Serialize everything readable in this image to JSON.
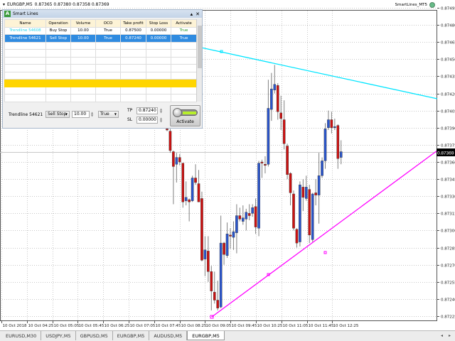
{
  "header": {
    "symbol": "EURGBP,M5",
    "prices": "0.87365 0.87380 0.87358 0.87369",
    "ea_name": "SmartLines_MT5"
  },
  "chart_data": {
    "type": "candlestick",
    "symbol": "EURGBP",
    "timeframe": "M5",
    "y_ticks": [
      "0.87495",
      "0.87480",
      "0.87465",
      "0.87450",
      "0.87435",
      "0.87420",
      "0.87405",
      "0.87390",
      "0.87375",
      "0.87360",
      "0.87345",
      "0.87330",
      "0.87315",
      "0.87300",
      "0.87285",
      "0.87270",
      "0.87255",
      "0.87240",
      "0.87225"
    ],
    "ylim": [
      0.87225,
      0.87495
    ],
    "x_ticks": [
      "10 Oct 2018",
      "10 Oct 04:25",
      "10 Oct 05:05",
      "10 Oct 05:45",
      "10 Oct 06:25",
      "10 Oct 07:05",
      "10 Oct 07:45",
      "10 Oct 08:25",
      "10 Oct 09:05",
      "10 Oct 09:45",
      "10 Oct 10:25",
      "10 Oct 11:05",
      "10 Oct 11:45",
      "10 Oct 12:25"
    ],
    "current_price": "0.87369",
    "bull_color": "#2a55cc",
    "bear_color": "#cc1111",
    "candles_ohlc_1e5": [
      [
        87389,
        87390,
        87387,
        87388
      ],
      [
        87387,
        87389,
        87368,
        87370
      ],
      [
        87369,
        87370,
        87323,
        87356
      ],
      [
        87358,
        87368,
        87342,
        87364
      ],
      [
        87364,
        87367,
        87357,
        87360
      ],
      [
        87359,
        87359,
        87320,
        87325
      ],
      [
        87326,
        87343,
        87322,
        87329
      ],
      [
        87327,
        87328,
        87308,
        87325
      ],
      [
        87326,
        87348,
        87325,
        87346
      ],
      [
        87346,
        87358,
        87340,
        87342
      ],
      [
        87341,
        87353,
        87325,
        87325
      ],
      [
        87328,
        87334,
        87273,
        87274
      ],
      [
        87275,
        87295,
        87260,
        87283
      ],
      [
        87282,
        87295,
        87255,
        87264
      ],
      [
        87264,
        87269,
        87230,
        87247
      ],
      [
        87246,
        87264,
        87236,
        87239
      ],
      [
        87239,
        87256,
        87230,
        87232
      ],
      [
        87233,
        87313,
        87232,
        87289
      ],
      [
        87289,
        87290,
        87270,
        87279
      ],
      [
        87278,
        87307,
        87276,
        87297
      ],
      [
        87296,
        87302,
        87284,
        87295
      ],
      [
        87294,
        87308,
        87283,
        87299
      ],
      [
        87298,
        87323,
        87280,
        87313
      ],
      [
        87313,
        87320,
        87308,
        87310
      ],
      [
        87308,
        87322,
        87305,
        87311
      ],
      [
        87310,
        87319,
        87300,
        87316
      ],
      [
        87315,
        87323,
        87309,
        87313
      ],
      [
        87315,
        87323,
        87312,
        87320
      ],
      [
        87321,
        87328,
        87297,
        87303
      ],
      [
        87302,
        87361,
        87295,
        87359
      ],
      [
        87360,
        87362,
        87346,
        87359
      ],
      [
        87358,
        87365,
        87350,
        87357
      ],
      [
        87358,
        87432,
        87356,
        87407
      ],
      [
        87406,
        87438,
        87396,
        87424
      ],
      [
        87423,
        87445,
        87420,
        87428
      ],
      [
        87427,
        87429,
        87397,
        87404
      ],
      [
        87403,
        87418,
        87388,
        87398
      ],
      [
        87397,
        87414,
        87371,
        87376
      ],
      [
        87374,
        87376,
        87345,
        87349
      ],
      [
        87350,
        87351,
        87322,
        87333
      ],
      [
        87332,
        87335,
        87300,
        87302
      ],
      [
        87301,
        87302,
        87285,
        87289
      ],
      [
        87290,
        87343,
        87286,
        87340
      ],
      [
        87338,
        87345,
        87317,
        87329
      ],
      [
        87328,
        87348,
        87326,
        87338
      ],
      [
        87336,
        87340,
        87289,
        87296
      ],
      [
        87292,
        87333,
        87290,
        87332
      ],
      [
        87333,
        87345,
        87322,
        87331
      ],
      [
        87331,
        87368,
        87306,
        87348
      ],
      [
        87348,
        87364,
        87346,
        87361
      ],
      [
        87361,
        87394,
        87354,
        87389
      ],
      [
        87390,
        87405,
        87388,
        87397
      ],
      [
        87397,
        87404,
        87385,
        87390
      ],
      [
        87390,
        87398,
        87388,
        87391
      ],
      [
        87392,
        87393,
        87354,
        87363
      ],
      [
        87364,
        87379,
        87358,
        87369
      ]
    ],
    "trendlines": [
      {
        "name": "Trendline 54608",
        "color": "#00e5ff"
      },
      {
        "name": "Trendline 54621",
        "color": "#ff00ff"
      }
    ]
  },
  "panel": {
    "title": "Smart Lines",
    "columns": [
      "Name",
      "Operation",
      "Volume",
      "OCO",
      "Take profit",
      "Stop Loss",
      "Activate"
    ],
    "rows": [
      [
        "Trendline 54608",
        "Buy Stop",
        "10.00",
        "True",
        "0.87500",
        "0.00000",
        "True"
      ],
      [
        "Trendline 54621",
        "Sell Stop",
        "10.00",
        "True",
        "0.87240",
        "0.00000",
        "True"
      ]
    ],
    "form": {
      "name": "Trendline 54621",
      "operation": "Sell Stop",
      "volume": "10.00",
      "oco": "True",
      "tp_label": "TP",
      "tp": "0.87240",
      "sl_label": "SL",
      "sl": "0.00000",
      "activate_label": "Activate"
    }
  },
  "tabs": [
    "EURUSD,M30",
    "USDJPY,M5",
    "GBPUSD,M5",
    "EURGBP,M5",
    "AUDUSD,M5",
    "EURGBP,M5"
  ],
  "active_tab": 5
}
